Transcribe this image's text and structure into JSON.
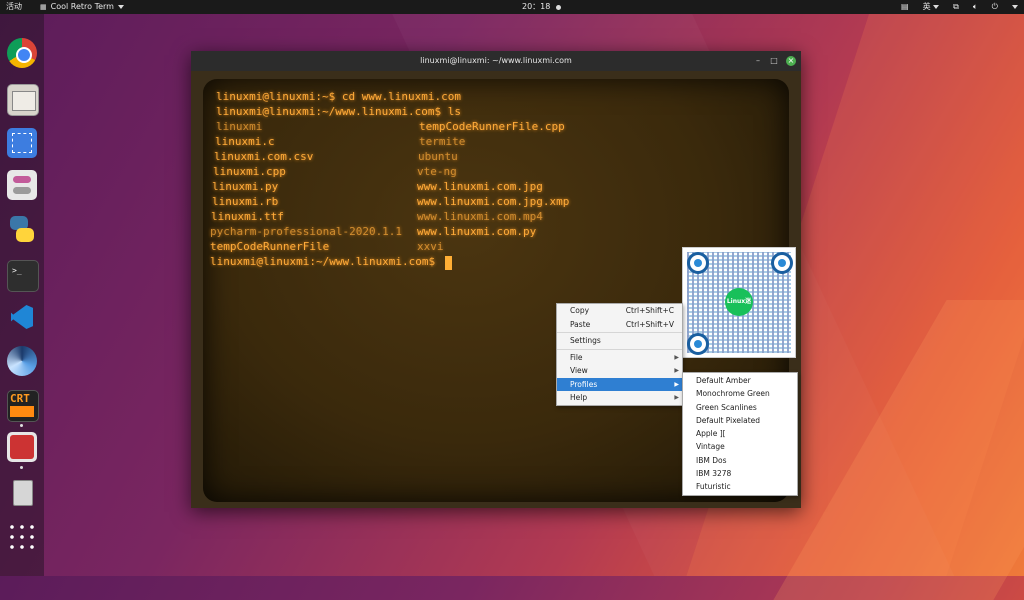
{
  "topbar": {
    "activities": "活动",
    "app_name": "Cool Retro Term",
    "clock": "20：18",
    "input_method": "英"
  },
  "window": {
    "title": "linuxmi@linuxmi: ~/www.linuxmi.com"
  },
  "terminal": {
    "lines": [
      "linuxmi@linuxmi:~$ cd www.linuxmi.com",
      "linuxmi@linuxmi:~/www.linuxmi.com$ ls"
    ],
    "col1": [
      "linuxmi",
      "linuxmi.c",
      "linuxmi.com.csv",
      "linuxmi.cpp",
      "linuxmi.py",
      "linuxmi.rb",
      "linuxmi.ttf",
      "pycharm-professional-2020.1.1",
      "tempCodeRunnerFile"
    ],
    "col2": [
      "tempCodeRunnerFile.cpp",
      "termite",
      "ubuntu",
      "vte-ng",
      "www.linuxmi.com.jpg",
      "www.linuxmi.com.jpg.xmp",
      "www.linuxmi.com.mp4",
      "www.linuxmi.com.py",
      "xxvi"
    ],
    "prompt": "linuxmi@linuxmi:~/www.linuxmi.com$"
  },
  "context_menu": {
    "copy": "Copy",
    "copy_shortcut": "Ctrl+Shift+C",
    "paste": "Paste",
    "paste_shortcut": "Ctrl+Shift+V",
    "settings": "Settings",
    "file": "File",
    "view": "View",
    "profiles": "Profiles",
    "help": "Help"
  },
  "profiles_menu": [
    "Default Amber",
    "Monochrome Green",
    "Green Scanlines",
    "Default Pixelated",
    "Apple ][",
    "Vintage",
    "IBM Dos",
    "IBM 3278",
    "Futuristic"
  ],
  "qr": {
    "logo_text": "Linux迷"
  },
  "colors": {
    "terminal_amber": "#ffab3a",
    "menu_highlight": "#2f7fd2"
  }
}
